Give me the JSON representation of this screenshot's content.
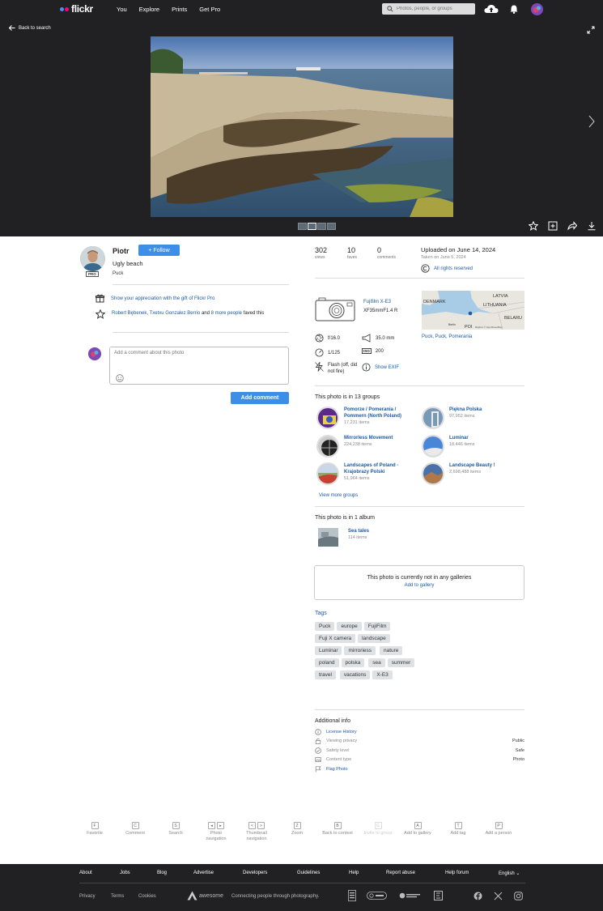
{
  "nav": {
    "logo_text": "flickr",
    "links": [
      "You",
      "Explore",
      "Prints",
      "Get Pro"
    ],
    "search_placeholder": "Photos, people, or groups"
  },
  "photo_area": {
    "back_label": "Back to search"
  },
  "owner": {
    "name": "Piotr",
    "follow_label": "+ Follow",
    "pro_badge": "PRO"
  },
  "photo": {
    "title": "Ugly beach",
    "description": "Puck"
  },
  "appreciation": {
    "text": "Show your appreciation with the gift of Flickr Pro"
  },
  "faves_line": {
    "names": "Robert Bębenek, Txetxu Gonzalez Berrio",
    "and_text": "and",
    "more": "8 more people",
    "suffix": "faved this"
  },
  "comment": {
    "placeholder": "Add a comment about this photo",
    "button": "Add comment"
  },
  "stats": [
    {
      "value": "302",
      "label": "views"
    },
    {
      "value": "10",
      "label": "faves"
    },
    {
      "value": "0",
      "label": "comments"
    }
  ],
  "dates": {
    "uploaded": "Uploaded on June 14, 2024",
    "taken": "Taken on June 5, 2024",
    "rights": "All rights reserved"
  },
  "camera": {
    "name": "Fujifilm X-E3",
    "lens": "XF35mmF1.4 R"
  },
  "map": {
    "labels": [
      "LATVIA",
      "DENMARK",
      "LITHUANIA",
      "BELARU",
      "POI",
      "Berlin"
    ],
    "attribution": "Mapbox  © OpenStreetMap"
  },
  "location": "Puck, Puck, Pomerania",
  "exif": {
    "aperture": "f/16.0",
    "focal": "35.0 mm",
    "shutter": "1/125",
    "iso": "200",
    "iso_label": "ISO",
    "flash": "Flash (off, did not fire)",
    "show_exif": "Show EXIF"
  },
  "groups": {
    "title": "This photo is in 13 groups",
    "items": [
      {
        "name": "Pomorze / Pomerania / Pommern (North Poland)",
        "count": "17,231 items"
      },
      {
        "name": "Piękna Polska",
        "count": "97,952 items"
      },
      {
        "name": "Mirrorless Movement",
        "count": "224,238 items"
      },
      {
        "name": "Luminar",
        "count": "18,446 items"
      },
      {
        "name": "Landscapes of Poland - Krajobrazy Polski",
        "count": "51,964 items"
      },
      {
        "name": "Landscape Beauty !",
        "count": "2,698,488 items"
      }
    ],
    "view_more": "View more groups"
  },
  "albums": {
    "title": "This photo is in 1 album",
    "name": "Sea tales",
    "count": "114 items"
  },
  "galleries": {
    "text": "This photo is currently not in any galleries",
    "add": "Add to gallery"
  },
  "tags": {
    "title": "Tags",
    "items": [
      "Puck",
      "europe",
      "FujiFilm",
      "Fuji X camera",
      "landscape",
      "Luminar",
      "mirroriess",
      "nature",
      "poland",
      "polska",
      "sea",
      "summer",
      "travel",
      "vacations",
      "X-E3"
    ]
  },
  "additional": {
    "title": "Additional info",
    "license": "License History",
    "privacy_label": "Viewing privacy",
    "privacy_value": "Public",
    "safety_label": "Safety level",
    "safety_value": "Safe",
    "content_label": "Content type",
    "content_value": "Photo",
    "flag": "Flag Photo"
  },
  "shortcuts": [
    {
      "keys": [
        "F"
      ],
      "label": "Favorite"
    },
    {
      "keys": [
        "C"
      ],
      "label": "Comment"
    },
    {
      "keys": [
        "S"
      ],
      "label": "Search"
    },
    {
      "keys": [
        "◂",
        "▸"
      ],
      "label": "Photo navigation"
    },
    {
      "keys": [
        "<",
        ">"
      ],
      "label": "Thumbnail navigation"
    },
    {
      "keys": [
        "Z"
      ],
      "label": "Zoom"
    },
    {
      "keys": [
        "B"
      ],
      "label": "Back to context"
    },
    {
      "keys": [
        "G"
      ],
      "label": "Invite to group"
    },
    {
      "keys": [
        "A"
      ],
      "label": "Add to gallery"
    },
    {
      "keys": [
        "T"
      ],
      "label": "Add tag"
    },
    {
      "keys": [
        "P"
      ],
      "label": "Add a person"
    }
  ],
  "footer": {
    "links": [
      "About",
      "Jobs",
      "Blog",
      "Advertise",
      "Developers",
      "Guidelines",
      "Help",
      "Report abuse",
      "Help forum"
    ],
    "language": "English",
    "legal": [
      "Privacy",
      "Terms",
      "Cookies"
    ],
    "tagline": "Connecting people through photography.",
    "smug": "awesome"
  },
  "colors": {
    "accent": "#3d8ee8",
    "link": "#1c5aa5",
    "dark": "#212124"
  }
}
